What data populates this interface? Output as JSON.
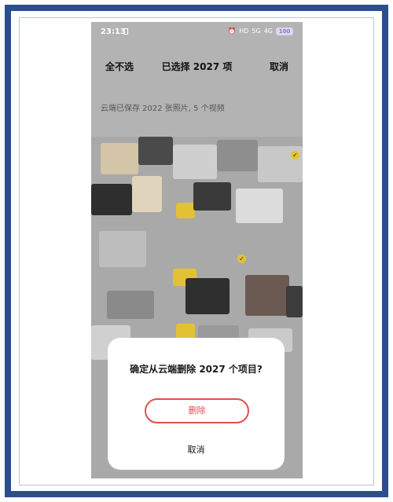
{
  "status_bar": {
    "time": "23:13",
    "icons": [
      "alarm-icon",
      "volte-icon",
      "5g-signal-icon",
      "4g-signal-icon"
    ],
    "icon_text": [
      "⏰",
      "HD",
      "5G",
      "4G"
    ],
    "battery": "100"
  },
  "top_bar": {
    "select_none": "全不选",
    "title": "已选择 2027 项",
    "cancel": "取消"
  },
  "cloud_info": "云端已保存 2022 张照片, 5 个视频",
  "dialog": {
    "title": "确定从云端删除 2027 个项目?",
    "delete_label": "删除",
    "cancel_label": "取消"
  },
  "colors": {
    "frame_border": "#2b4f8c",
    "delete_red": "#dc5050",
    "check_yellow": "#e2c232",
    "dim_overlay": "#b3b3b3"
  }
}
